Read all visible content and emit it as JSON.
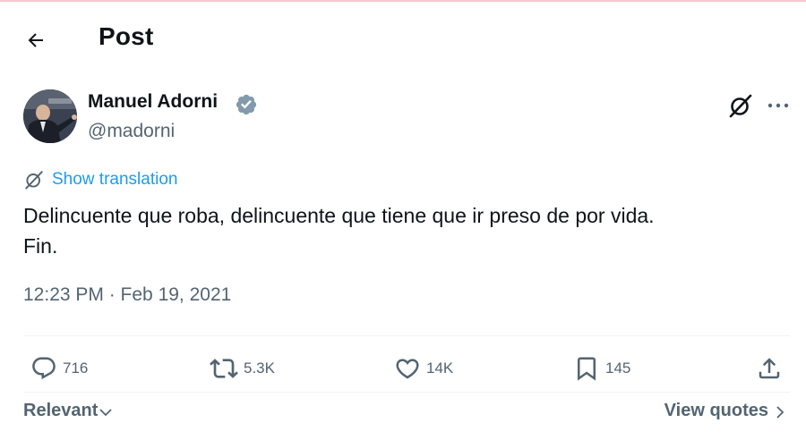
{
  "header": {
    "title": "Post",
    "back_icon": "arrow-left-icon"
  },
  "post": {
    "author_name": "Manuel Adorni",
    "handle": "@madorni",
    "verified": true,
    "translate_label": "Show translation",
    "text": "Delincuente que roba, delincuente que tiene que ir preso de por vida.\nFin.",
    "timestamp": "12:23 PM · Feb 19, 2021"
  },
  "actions": {
    "replies": "716",
    "reposts": "5.3K",
    "likes": "14K",
    "bookmarks": "145"
  },
  "footer": {
    "sort_label": "Relevant",
    "view_quotes_label": "View quotes"
  },
  "colors": {
    "accent": "#1d9bf0",
    "verified": "#829aab",
    "secondary_text": "#536471",
    "primary_text": "#0f1419"
  }
}
